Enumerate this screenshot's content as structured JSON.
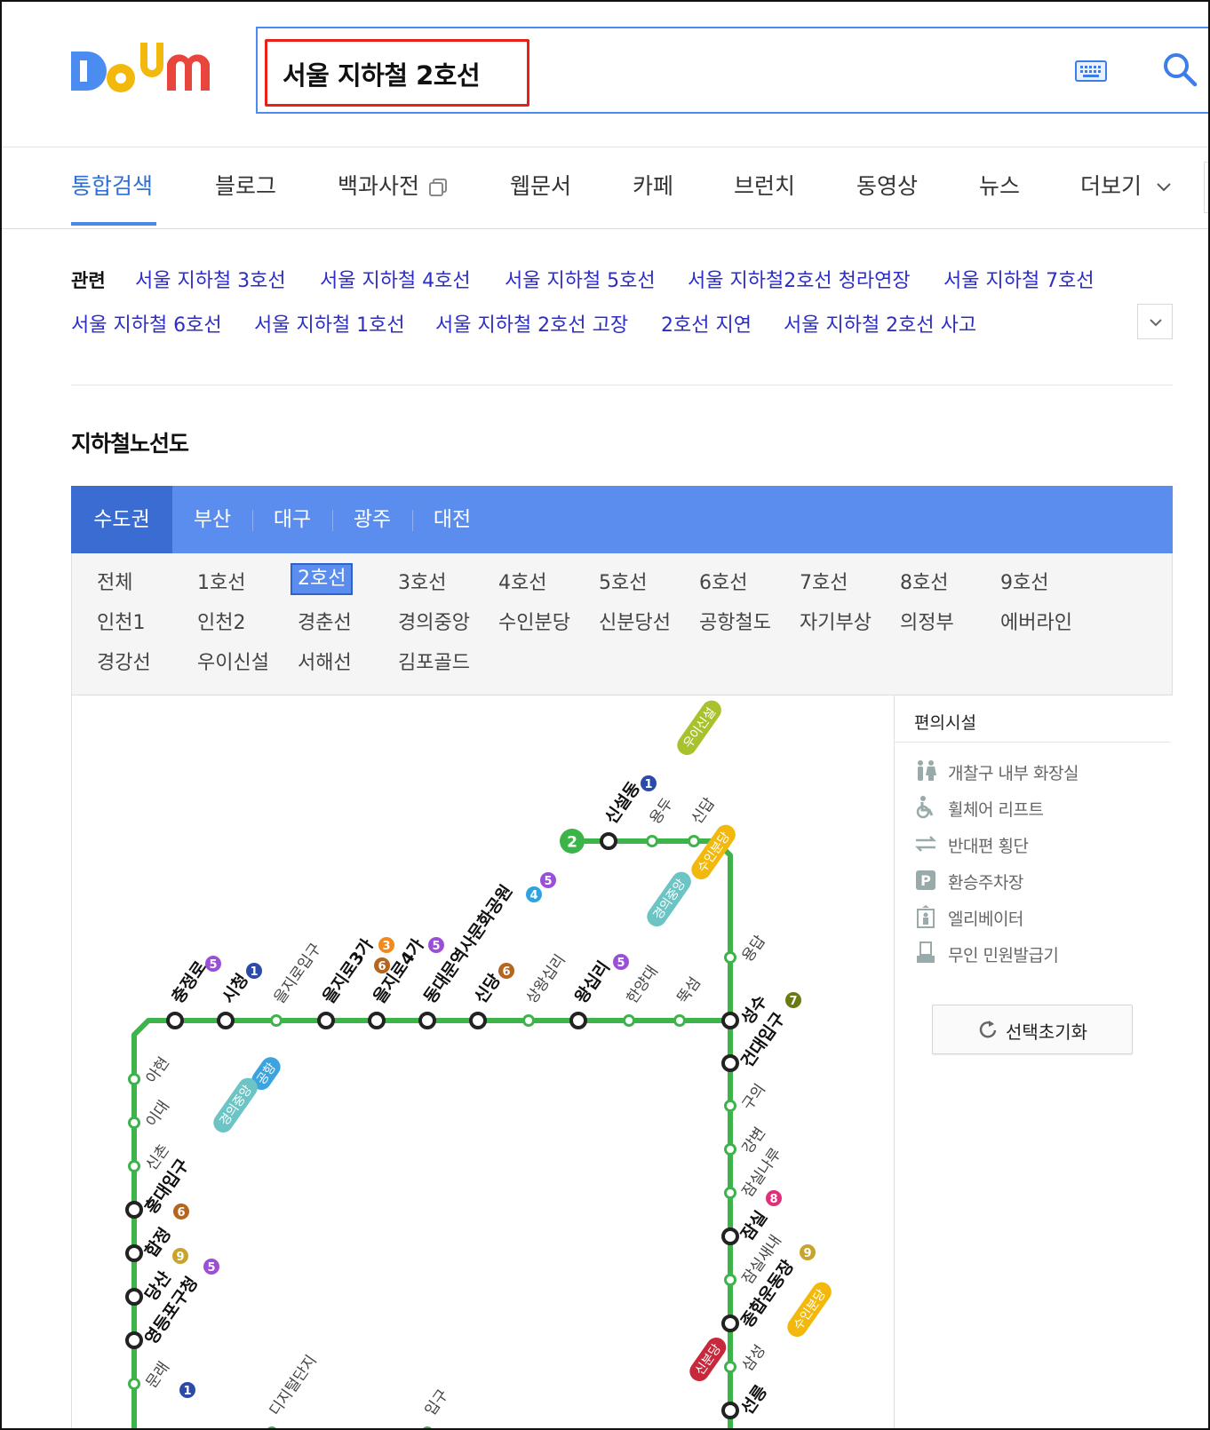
{
  "header": {
    "logo_text": "Daum",
    "search_query": "서울 지하철 2호선"
  },
  "tabs": [
    {
      "label": "통합검색",
      "active": true
    },
    {
      "label": "블로그"
    },
    {
      "label": "백과사전"
    },
    {
      "label": "웹문서"
    },
    {
      "label": "카페"
    },
    {
      "label": "브런치"
    },
    {
      "label": "동영상"
    },
    {
      "label": "뉴스"
    },
    {
      "label": "더보기"
    }
  ],
  "related": {
    "label": "관련",
    "links": [
      "서울 지하철 3호선",
      "서울 지하철 4호선",
      "서울 지하철 5호선",
      "서울 지하철2호선 청라연장",
      "서울 지하철 7호선",
      "서울 지하철 6호선",
      "서울 지하철 1호선",
      "서울 지하철 2호선 고장",
      "2호선 지연",
      "서울 지하철 2호선 사고"
    ]
  },
  "subway": {
    "title": "지하철노선도",
    "regions": [
      "수도권",
      "부산",
      "대구",
      "광주",
      "대전"
    ],
    "active_region": "수도권",
    "lines": [
      "전체",
      "1호선",
      "2호선",
      "3호선",
      "4호선",
      "5호선",
      "6호선",
      "7호선",
      "8호선",
      "9호선",
      "인천1",
      "인천2",
      "경춘선",
      "경의중앙",
      "수인분당",
      "신분당선",
      "공항철도",
      "자기부상",
      "의정부",
      "에버라인",
      "경강선",
      "우이신설",
      "서해선",
      "김포골드"
    ],
    "active_line": "2호선",
    "line_badge": "2",
    "line_color": "#3cb44a"
  },
  "map": {
    "stations": [
      {
        "name": "신설동",
        "bold": true
      },
      {
        "name": "용두"
      },
      {
        "name": "신답"
      },
      {
        "name": "용답"
      },
      {
        "name": "성수",
        "bold": true
      },
      {
        "name": "건대입구",
        "bold": true
      },
      {
        "name": "구의"
      },
      {
        "name": "강변"
      },
      {
        "name": "잠실나루"
      },
      {
        "name": "잠실",
        "bold": true
      },
      {
        "name": "잠실새내"
      },
      {
        "name": "종합운동장",
        "bold": true
      },
      {
        "name": "삼성"
      },
      {
        "name": "선릉",
        "bold": true
      },
      {
        "name": "충정로",
        "bold": true
      },
      {
        "name": "시청",
        "bold": true
      },
      {
        "name": "을지로입구"
      },
      {
        "name": "을지로3가",
        "bold": true
      },
      {
        "name": "을지로4가",
        "bold": true
      },
      {
        "name": "동대문역사문화공원",
        "bold": true
      },
      {
        "name": "신당",
        "bold": true
      },
      {
        "name": "상왕십리"
      },
      {
        "name": "왕십리",
        "bold": true
      },
      {
        "name": "한양대"
      },
      {
        "name": "뚝섬"
      },
      {
        "name": "아현"
      },
      {
        "name": "이대"
      },
      {
        "name": "신촌"
      },
      {
        "name": "홍대입구",
        "bold": true
      },
      {
        "name": "합정",
        "bold": true
      },
      {
        "name": "당산",
        "bold": true
      },
      {
        "name": "영등포구청",
        "bold": true
      },
      {
        "name": "문래"
      },
      {
        "name": "디지털단지"
      },
      {
        "name": "입구"
      }
    ],
    "transfer_badges": [
      {
        "text": "우이신설",
        "color": "#a7c22c"
      },
      {
        "text": "1",
        "color": "#2c4ba8"
      },
      {
        "text": "4",
        "color": "#2fa3df"
      },
      {
        "text": "5",
        "color": "#9b4fd6"
      },
      {
        "text": "수인분당",
        "color": "#f2b90c"
      },
      {
        "text": "경의중앙",
        "color": "#6cc4c4"
      },
      {
        "text": "6",
        "color": "#b5651d"
      },
      {
        "text": "3",
        "color": "#f08a1c"
      },
      {
        "text": "7",
        "color": "#6c7a12"
      },
      {
        "text": "8",
        "color": "#e0307c"
      },
      {
        "text": "9",
        "color": "#c8a42c"
      },
      {
        "text": "공항",
        "color": "#3aa3e0"
      },
      {
        "text": "신분당",
        "color": "#c8283c"
      }
    ]
  },
  "facilities": {
    "title": "편의시설",
    "items": [
      {
        "label": "개찰구 내부 화장실",
        "icon": "restroom-icon"
      },
      {
        "label": "휠체어 리프트",
        "icon": "wheelchair-icon"
      },
      {
        "label": "반대편 횡단",
        "icon": "crossing-icon"
      },
      {
        "label": "환승주차장",
        "icon": "parking-icon"
      },
      {
        "label": "엘리베이터",
        "icon": "elevator-icon"
      },
      {
        "label": "무인 민원발급기",
        "icon": "kiosk-icon"
      }
    ],
    "reset_label": "선택초기화"
  }
}
